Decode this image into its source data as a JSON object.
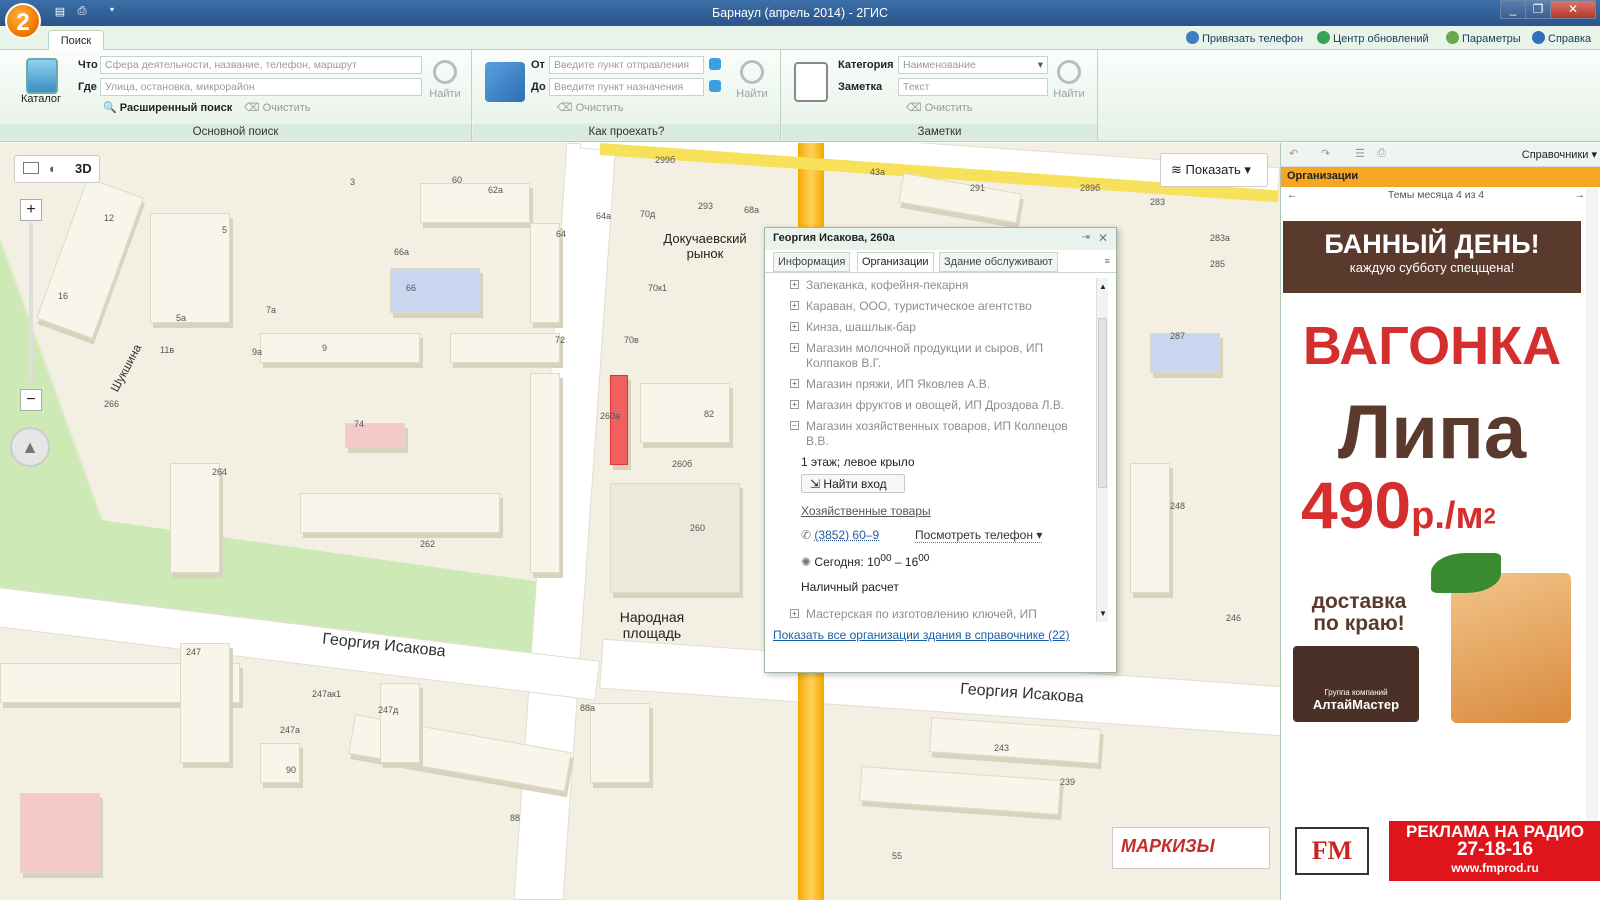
{
  "window": {
    "title": "Барнаул (апрель 2014) - 2ГИС",
    "logo_text": "2",
    "controls": [
      "_",
      "❐",
      "✕"
    ]
  },
  "tabs": {
    "search": "Поиск"
  },
  "top_links": {
    "bind_phone": "Привязать телефон",
    "update_center": "Центр обновлений",
    "parameters": "Параметры",
    "help": "Справка"
  },
  "main_search": {
    "catalog_label": "Каталог",
    "what_label": "Что",
    "what_placeholder": "Сфера деятельности, название, телефон, маршрут",
    "where_label": "Где",
    "where_placeholder": "Улица, остановка, микрорайон",
    "advanced_label": "Расширенный поиск",
    "clear_label": "Очистить",
    "find_label": "Найти",
    "group_title": "Основной поиск"
  },
  "route": {
    "from_label": "От",
    "from_placeholder": "Введите пункт отправления",
    "to_label": "До",
    "to_placeholder": "Введите пункт назначения",
    "clear_label": "Очистить",
    "find_label": "Найти",
    "group_title": "Как проехать?"
  },
  "notes": {
    "category_label": "Категория",
    "category_placeholder": "Наименование",
    "note_label": "Заметка",
    "note_placeholder": "Текст",
    "clear_label": "Очистить",
    "find_label": "Найти",
    "group_title": "Заметки"
  },
  "map": {
    "show_button": "Показать",
    "mode_3d": "3D",
    "streets": {
      "isakova_1": "Георгия Исакова",
      "isakova_2": "Георгия Исакова",
      "shukshina": "Шукшина"
    },
    "places": {
      "market": "Докучаевский рынок",
      "square": "Народная площадь"
    },
    "house_numbers": [
      "3",
      "60",
      "62а",
      "299б",
      "43а",
      "291",
      "289б",
      "283",
      "283а",
      "285",
      "287",
      "12",
      "5",
      "16",
      "5а",
      "11в",
      "9а",
      "9",
      "66а",
      "66",
      "7а",
      "72",
      "64",
      "64а",
      "70д",
      "293",
      "68а",
      "70к1",
      "70в",
      "82",
      "260а",
      "260б",
      "260",
      "74",
      "264",
      "262",
      "266",
      "247",
      "247ак1",
      "247д",
      "247а",
      "88а",
      "90",
      "88",
      "243",
      "239",
      "248",
      "246",
      "55"
    ],
    "ad_markizy": "МАРКИЗЫ"
  },
  "popup": {
    "title": "Георгия Исакова, 260а",
    "tabs": [
      "Информация",
      "Организации",
      "Здание обслуживают"
    ],
    "orgs": [
      "Запеканка, кофейня-пекарня",
      "Караван, ООО, туристическое агентство",
      "Кинза, шашлык-бар",
      "Магазин молочной продукции и сыров, ИП",
      "Колпаков В.Г.",
      "Магазин пряжи, ИП Яковлев А.В.",
      "Магазин фруктов и овощей, ИП Дроздова Л.В.",
      "Магазин хозяйственных товаров, ИП Колпецов",
      "В.В."
    ],
    "floor": "1 этаж; левое крыло",
    "find_entrance": "Найти вход",
    "category": "Хозяйственные товары",
    "phone": "(3852) 60–9",
    "view_phone": "Посмотреть телефон",
    "hours_prefix": "Сегодня: 10",
    "hours_sup1": "00",
    "hours_mid": " – 16",
    "hours_sup2": "00",
    "payment": "Наличный расчет",
    "next_org": "Мастерская по изготовлению ключей, ИП",
    "footer_link": "Показать все организации здания в справочнике",
    "footer_count": "(22)"
  },
  "right_panel": {
    "reference_label": "Справочники",
    "section": "Организации",
    "month_themes": "Темы месяца 4 из 4",
    "ad_title": "БАННЫЙ ДЕНЬ!",
    "ad_sub": "каждую субботу спецщена!",
    "ad_vagonka": "ВАГОНКА",
    "ad_lipa": "Липа",
    "ad_price": "490",
    "ad_unit": "р./м",
    "ad_unit_sup": "2",
    "ad_delivery_1": "доставка",
    "ad_delivery_2": "по краю!",
    "ad_company_small": "Группа компаний",
    "ad_company": "АлтайМастер",
    "radio_1": "РЕКЛАМА НА РАДИО",
    "radio_2": "27-18-16",
    "radio_3": "www.fmprod.ru",
    "fm_logo": "FM"
  }
}
